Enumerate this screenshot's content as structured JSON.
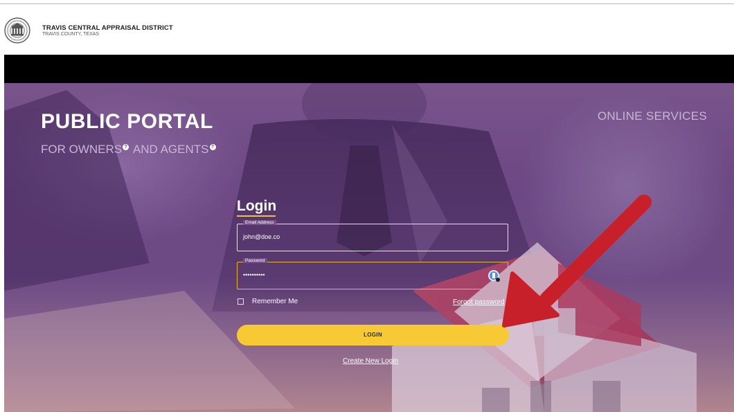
{
  "header": {
    "org_name": "TRAVIS CENTRAL APPRAISAL DISTRICT",
    "org_sub": "TRAVIS COUNTY, TEXAS",
    "logo_icon": "county-seal-icon"
  },
  "hero": {
    "title": "PUBLIC PORTAL",
    "subtitle_part1": "FOR OWNERS",
    "subtitle_part2": "AND AGENTS",
    "help_icon_glyph": "?",
    "online_services": "ONLINE SERVICES"
  },
  "login": {
    "title": "Login",
    "email_label": "Email Address",
    "email_value": "john@doe.co",
    "password_label": "Password",
    "password_value": "••••••••••",
    "remember_label": "Remember Me",
    "remember_checked": false,
    "forgot_label": "Forgot password",
    "login_button": "LOGIN",
    "create_login": "Create New Login"
  },
  "colors": {
    "accent_yellow": "#f6c935",
    "hero_purple": "#6e4b84",
    "annotation_red": "#c8202a"
  }
}
